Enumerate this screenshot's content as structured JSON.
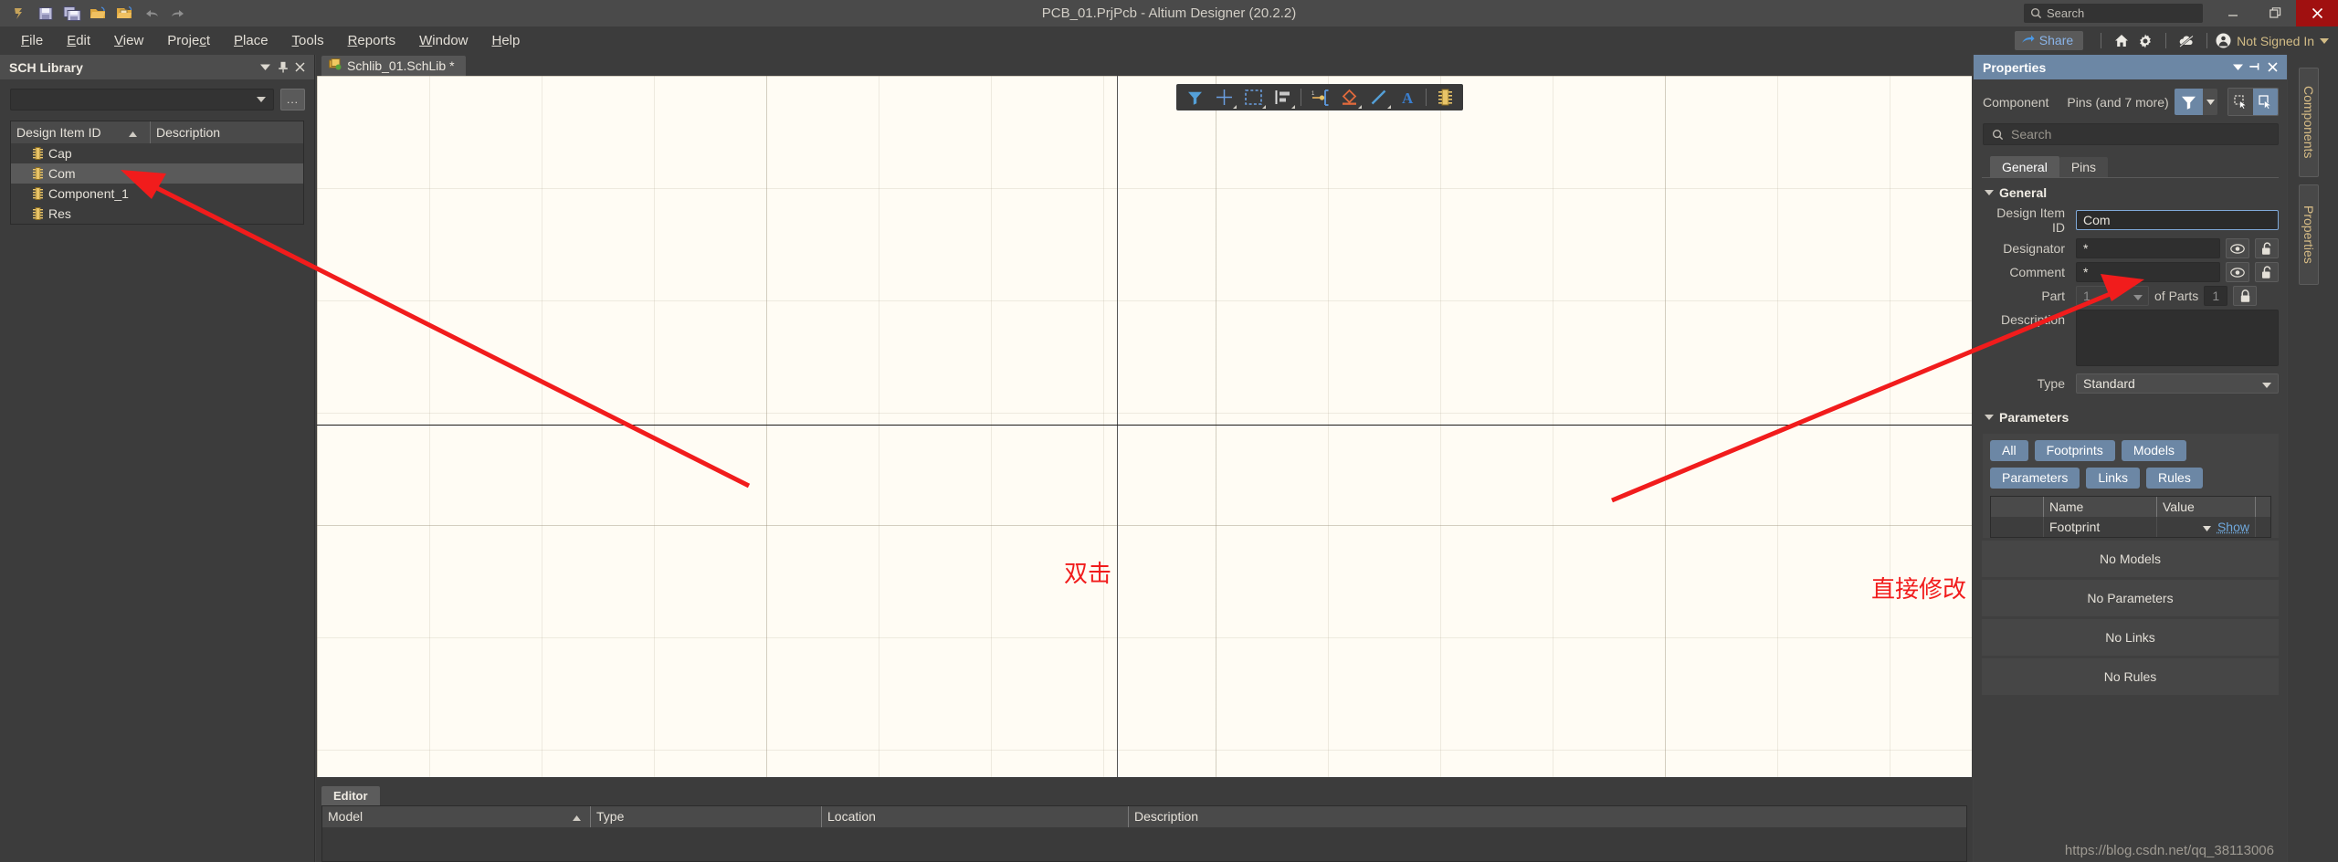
{
  "window": {
    "title": "PCB_01.PrjPcb - Altium Designer (20.2.2)",
    "search_placeholder": "Search",
    "minimize": "–",
    "restore": "❐",
    "close": "✕"
  },
  "quick_access": [
    {
      "name": "altium-logo-icon",
      "label": "A"
    },
    {
      "name": "save-icon",
      "label": "Save"
    },
    {
      "name": "save-all-icon",
      "label": "Save All"
    },
    {
      "name": "open-icon",
      "label": "Open"
    },
    {
      "name": "open-project-icon",
      "label": "Open Project"
    },
    {
      "name": "undo-icon",
      "label": "Undo"
    },
    {
      "name": "redo-icon",
      "label": "Redo"
    }
  ],
  "menubar": {
    "items": [
      {
        "pre": "",
        "acc": "F",
        "post": "ile"
      },
      {
        "pre": "",
        "acc": "E",
        "post": "dit"
      },
      {
        "pre": "",
        "acc": "V",
        "post": "iew"
      },
      {
        "pre": "Proje",
        "acc": "c",
        "post": "t"
      },
      {
        "pre": "",
        "acc": "P",
        "post": "lace"
      },
      {
        "pre": "",
        "acc": "T",
        "post": "ools"
      },
      {
        "pre": "",
        "acc": "R",
        "post": "eports"
      },
      {
        "pre": "",
        "acc": "W",
        "post": "indow"
      },
      {
        "pre": "",
        "acc": "H",
        "post": "elp"
      }
    ],
    "share_label": "Share",
    "account_label": "Not Signed In",
    "icons": [
      "home-icon",
      "gear-icon",
      "cloud-disconnected-icon",
      "account-circle-icon"
    ]
  },
  "sch_library": {
    "title": "SCH Library",
    "library_selected": "",
    "browse_label": "...",
    "columns": [
      "Design Item ID",
      "Description"
    ],
    "sort_column": "Design Item ID",
    "sort_direction": "ascending",
    "rows": [
      {
        "id": "Cap",
        "description": "",
        "selected": false
      },
      {
        "id": "Com",
        "description": "",
        "selected": true
      },
      {
        "id": "Component_1",
        "description": "",
        "selected": false
      },
      {
        "id": "Res",
        "description": "",
        "selected": false
      }
    ],
    "header_buttons": [
      "chevron-down-icon",
      "pin-icon",
      "close-icon"
    ]
  },
  "document": {
    "tab_label": "Schlib_01.SchLib *"
  },
  "canvas": {
    "background_color": "#fffcf4",
    "annotations": [
      {
        "text": "双击",
        "color": "#f11c1c"
      },
      {
        "text": "直接修改",
        "color": "#f11c1c"
      }
    ],
    "toolbar": [
      {
        "name": "filter-icon",
        "active": true,
        "dropdown": false
      },
      {
        "name": "crosshair-icon",
        "active": false,
        "dropdown": true
      },
      {
        "name": "selection-rect-icon",
        "active": false,
        "dropdown": true
      },
      {
        "name": "align-icon",
        "active": false,
        "dropdown": true
      },
      {
        "name": "place-pin-icon",
        "active": false,
        "dropdown": false
      },
      {
        "name": "place-ieee-symbol-icon",
        "active": false,
        "dropdown": true
      },
      {
        "name": "place-line-icon",
        "active": false,
        "dropdown": true
      },
      {
        "name": "place-text-icon",
        "active": false,
        "dropdown": false
      },
      {
        "name": "place-component-icon",
        "active": false,
        "dropdown": false
      }
    ]
  },
  "editor_panel": {
    "tab_label": "Editor",
    "columns": [
      "Model",
      "Type",
      "Location",
      "Description"
    ],
    "sort_column": "Model",
    "rows": []
  },
  "properties": {
    "title": "Properties",
    "header_buttons": [
      "chevron-down-icon",
      "pin-icon",
      "close-icon"
    ],
    "object_type": "Component",
    "object_scope": "Pins (and 7 more)",
    "search_placeholder": "Search",
    "tabs": [
      {
        "label": "General",
        "active": true
      },
      {
        "label": "Pins",
        "active": false
      }
    ],
    "general": {
      "section_title": "General",
      "design_item_id": {
        "label": "Design Item ID",
        "value": "Com",
        "focused": true
      },
      "designator": {
        "label": "Designator",
        "value": "*",
        "visible_icon": "eye-icon",
        "lock_icon": "unlock-icon"
      },
      "comment": {
        "label": "Comment",
        "value": "*",
        "visible_icon": "eye-icon",
        "lock_icon": "unlock-icon"
      },
      "part": {
        "label": "Part",
        "value": "1",
        "of_parts_label": "of Parts",
        "of_parts_value": "1",
        "lock_icon": "lock-icon"
      },
      "description": {
        "label": "Description",
        "value": ""
      },
      "type": {
        "label": "Type",
        "value": "Standard"
      }
    },
    "parameters": {
      "section_title": "Parameters",
      "filter_chips": [
        "All",
        "Footprints",
        "Models",
        "Parameters",
        "Links",
        "Rules"
      ],
      "columns": [
        "",
        "Name",
        "Value",
        ""
      ],
      "rows": [
        {
          "name": "Footprint",
          "value": "",
          "action": "Show"
        }
      ],
      "empty_states": [
        "No Models",
        "No Parameters",
        "No Links",
        "No Rules"
      ]
    }
  },
  "right_tabs": [
    {
      "label": "Components"
    },
    {
      "label": "Properties"
    }
  ],
  "watermark": "https://blog.csdn.net/qq_38113006",
  "colors": {
    "accent_blue": "#6c87a5",
    "panel_bg": "#3c3c3c",
    "canvas_bg": "#fffcf4",
    "annotation_red": "#f11c1c",
    "close_red": "#a01010",
    "link_blue": "#6fa8dc",
    "account_gold": "#d2bc86"
  }
}
